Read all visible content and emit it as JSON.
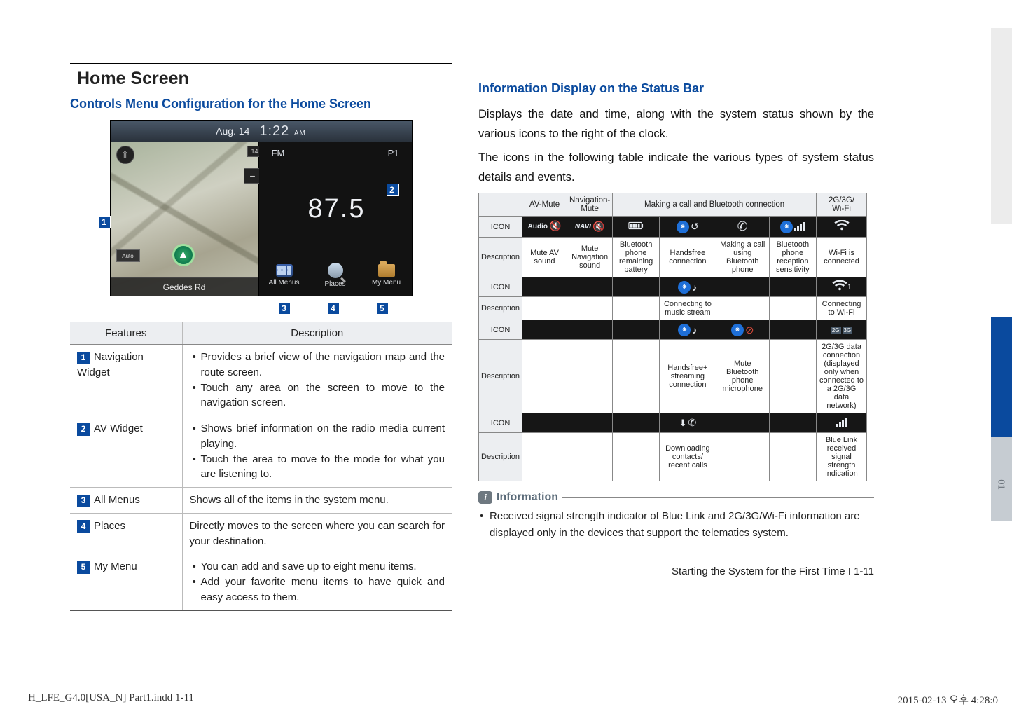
{
  "left": {
    "h1": "Home Screen",
    "h2": "Controls Menu Configuration for the Home Screen",
    "screenshot": {
      "date": "Aug. 14",
      "time": "1:22",
      "ampm": "AM",
      "zoom_badge": "14",
      "auto_btn": "Auto",
      "road": "Geddes Rd",
      "band": "FM",
      "preset": "P1",
      "freq": "87.5",
      "btn_allmenus": "All Menus",
      "btn_places": "Places",
      "btn_mymenu": "My Menu"
    },
    "callouts": {
      "c1": "1",
      "c2": "2",
      "c3": "3",
      "c4": "4",
      "c5": "5"
    },
    "feat_head_features": "Features",
    "feat_head_desc": "Description",
    "features": [
      {
        "num": "1",
        "name": "Navigation Widget",
        "bullets": [
          "Provides a brief view of the navigation map and the route screen.",
          "Touch any area on the screen to move to the navigation screen."
        ]
      },
      {
        "num": "2",
        "name": "AV Widget",
        "bullets": [
          "Shows brief information on the radio media current playing.",
          "Touch the area to move to the mode for what you are listening to."
        ]
      },
      {
        "num": "3",
        "name": "All Menus",
        "text": "Shows all of the items in the system menu."
      },
      {
        "num": "4",
        "name": "Places",
        "text": "Directly moves to the screen where you can search for your destination."
      },
      {
        "num": "5",
        "name": "My Menu",
        "bullets": [
          "You can add and save up to eight menu items.",
          "Add your favorite menu items to have quick and easy access to them."
        ]
      }
    ]
  },
  "right": {
    "h2": "Information Display on the Status Bar",
    "p1": "Displays the date and time, along with the system status shown by the various icons to the right of the clock.",
    "p2": "The icons in the following table indicate the various types of system status details and events.",
    "headers": {
      "avmute": "AV-Mute",
      "navmute": "Navigation-Mute",
      "btgroup": "Making a call and Bluetooth connection",
      "wifi": "2G/3G/\nWi-Fi"
    },
    "lbl_icon": "ICON",
    "lbl_desc": "Description",
    "row1": {
      "audio_label": "Audio",
      "navi_label": "NAVI",
      "d_av": "Mute AV sound",
      "d_nav": "Mute Navigation sound",
      "d_batt": "Bluetooth phone remaining battery",
      "d_hf": "Handsfree connection",
      "d_call": "Making a call using Bluetooth phone",
      "d_recep": "Bluetooth phone reception sensitivity",
      "d_wifi": "Wi-Fi is connected"
    },
    "row2": {
      "d_hf": "Connecting to music stream",
      "d_wifi": "Connecting to Wi-Fi"
    },
    "row3": {
      "d_hf": "Handsfree+ streaming connection",
      "d_call": "Mute Bluetooth phone microphone",
      "d_wifi": "2G/3G data connection (displayed only when connected to a 2G/3G data network)"
    },
    "row4": {
      "d_hf": "Downloading contacts/ recent calls",
      "d_wifi": "Blue Link received signal strength indication"
    },
    "info_title": "Information",
    "info_body": "Received signal strength indicator of Blue Link and 2G/3G/Wi-Fi information are displayed only in the devices that support the telematics system.",
    "footer_right": "Starting the System for the First Time I 1-11"
  },
  "doc_footer": {
    "left": "H_LFE_G4.0[USA_N] Part1.indd   1-11",
    "right": "2015-02-13   오후 4:28:0"
  },
  "side_tab_label": "01"
}
